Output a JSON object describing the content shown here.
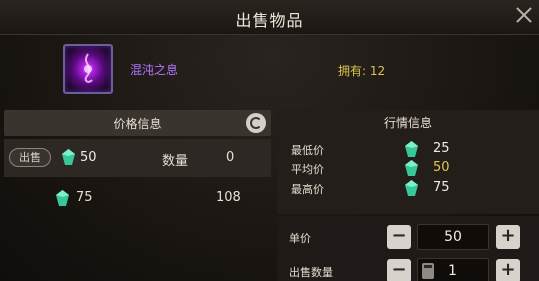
{
  "window": {
    "title": "出售物品"
  },
  "item": {
    "name": "混沌之息",
    "owned": "拥有: 12"
  },
  "price_panel": {
    "title": "价格信息",
    "my_listing": {
      "tag": "出售",
      "price": "50",
      "qty_label": "数量",
      "qty": "0"
    },
    "other_listing": {
      "price": "75",
      "qty": "108"
    }
  },
  "market": {
    "title": "行情信息",
    "rows": [
      {
        "label": "最低价",
        "value": "25",
        "color": "#f0ece4"
      },
      {
        "label": "平均价",
        "value": "50",
        "color": "#e1c454"
      },
      {
        "label": "最高价",
        "value": "75",
        "color": "#f0ece4"
      }
    ]
  },
  "controls": {
    "unit_price_label": "单价",
    "unit_price": "50",
    "sell_qty_label": "出售数量",
    "sell_qty": "1",
    "minus": "−",
    "plus": "+"
  },
  "colors": {
    "gem": "#3fd0a0",
    "accent": "#e1c454",
    "item_name": "#b476ff"
  }
}
